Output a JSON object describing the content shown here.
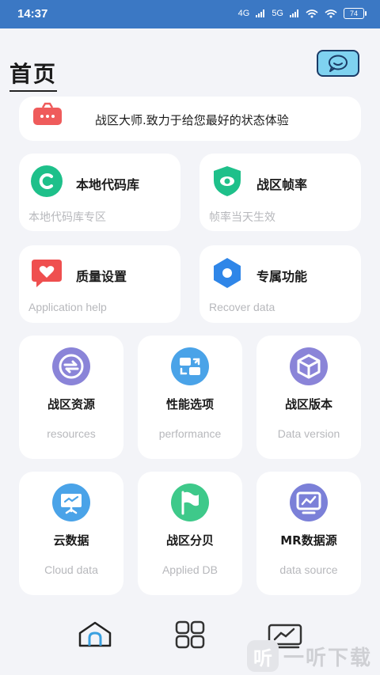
{
  "status_bar": {
    "time": "14:37",
    "net1": "4G",
    "net2": "5G",
    "battery": "74"
  },
  "header": {
    "title": "首页",
    "chat_icon": "chat-bubble-icon"
  },
  "banner": {
    "icon": "toolbox-icon",
    "text": "战区大师.致力于给您最好的状态体验"
  },
  "features": [
    {
      "icon": "c-letter-icon",
      "color": "#1ec08a",
      "title": "本地代码库",
      "subtitle": "本地代码库专区"
    },
    {
      "icon": "shield-eye-icon",
      "color": "#1ec08a",
      "title": "战区帧率",
      "subtitle": "帧率当天生效"
    },
    {
      "icon": "heart-chat-icon",
      "color": "#ef4f4f",
      "title": "质量设置",
      "subtitle": "Application help"
    },
    {
      "icon": "hexagon-icon",
      "color": "#2f86e8",
      "title": "专属功能",
      "subtitle": "Recover data"
    }
  ],
  "tiles": [
    {
      "icon": "swap-arrows-icon",
      "color": "#8a84d8",
      "title": "战区资源",
      "subtitle": "resources"
    },
    {
      "icon": "transfer-icon",
      "color": "#4aa3e8",
      "title": "性能选项",
      "subtitle": "performance"
    },
    {
      "icon": "cube-icon",
      "color": "#8a84d8",
      "title": "战区版本",
      "subtitle": "Data version"
    },
    {
      "icon": "presentation-icon",
      "color": "#4aa3e8",
      "title": "云数据",
      "subtitle": "Cloud data"
    },
    {
      "icon": "flag-icon",
      "color": "#3ec98a",
      "title": "战区分贝",
      "subtitle": "Applied DB"
    },
    {
      "icon": "monitor-chart-icon",
      "color": "#7b80d8",
      "title": "MR数据源",
      "subtitle": "data source"
    }
  ],
  "bottom_nav": [
    {
      "icon": "home-icon"
    },
    {
      "icon": "grid-icon"
    },
    {
      "icon": "chart-icon"
    }
  ],
  "watermark": {
    "logo": "听",
    "text": "一听下载"
  }
}
